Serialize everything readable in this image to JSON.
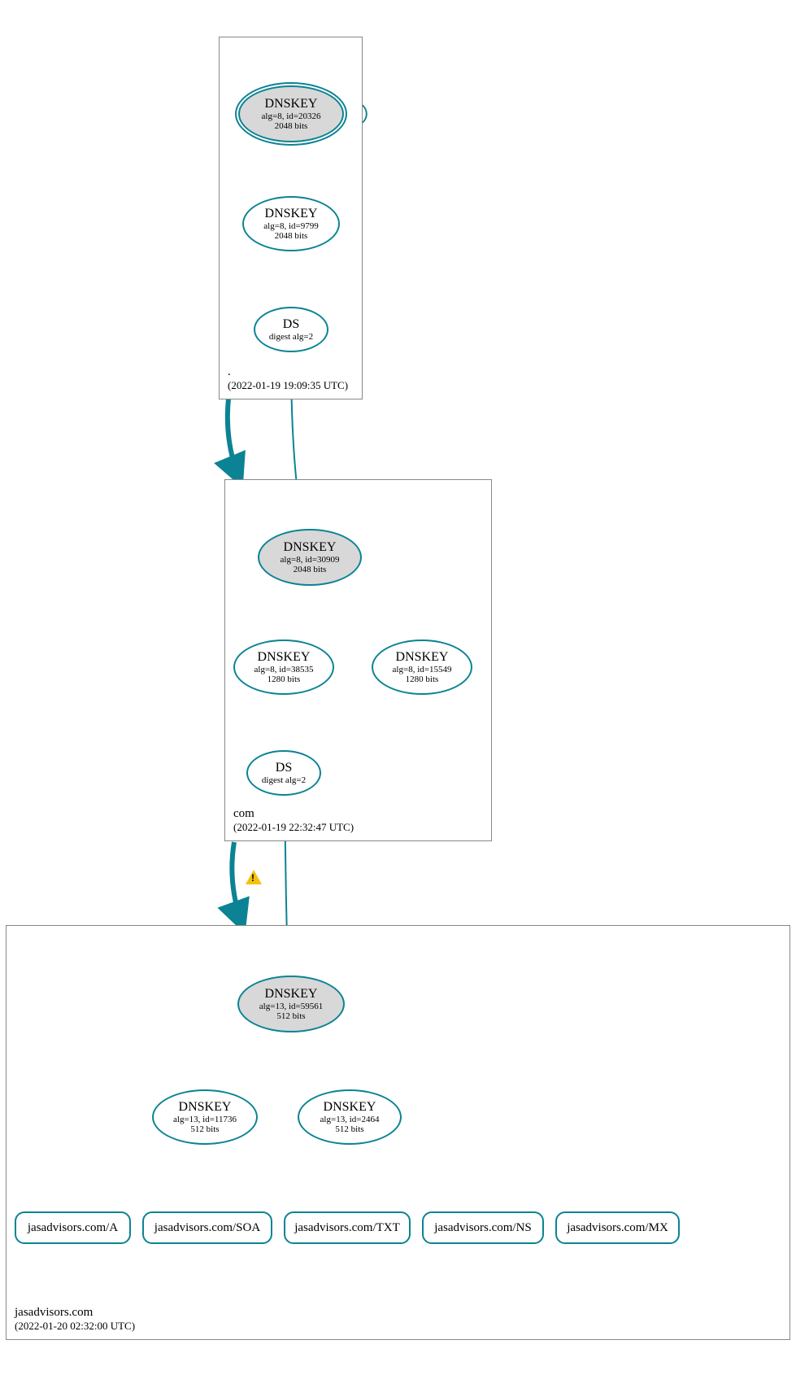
{
  "colors": {
    "teal": "#0b8394",
    "ksk_fill": "#d8d8d8"
  },
  "zones": {
    "root": {
      "name": ".",
      "time": "(2022-01-19 19:09:35 UTC)"
    },
    "com": {
      "name": "com",
      "time": "(2022-01-19 22:32:47 UTC)"
    },
    "domain": {
      "name": "jasadvisors.com",
      "time": "(2022-01-20 02:32:00 UTC)"
    }
  },
  "nodes": {
    "root_ksk": {
      "title": "DNSKEY",
      "l1": "alg=8, id=20326",
      "l2": "2048 bits"
    },
    "root_zsk": {
      "title": "DNSKEY",
      "l1": "alg=8, id=9799",
      "l2": "2048 bits"
    },
    "root_ds": {
      "title": "DS",
      "l1": "digest alg=2",
      "l2": ""
    },
    "com_ksk": {
      "title": "DNSKEY",
      "l1": "alg=8, id=30909",
      "l2": "2048 bits"
    },
    "com_zsk": {
      "title": "DNSKEY",
      "l1": "alg=8, id=38535",
      "l2": "1280 bits"
    },
    "com_zsk2": {
      "title": "DNSKEY",
      "l1": "alg=8, id=15549",
      "l2": "1280 bits"
    },
    "com_ds": {
      "title": "DS",
      "l1": "digest alg=2",
      "l2": ""
    },
    "dom_ksk": {
      "title": "DNSKEY",
      "l1": "alg=13, id=59561",
      "l2": "512 bits"
    },
    "dom_zsk2": {
      "title": "DNSKEY",
      "l1": "alg=13, id=11736",
      "l2": "512 bits"
    },
    "dom_zsk": {
      "title": "DNSKEY",
      "l1": "alg=13, id=2464",
      "l2": "512 bits"
    }
  },
  "rrset": {
    "a": "jasadvisors.com/A",
    "soa": "jasadvisors.com/SOA",
    "txt": "jasadvisors.com/TXT",
    "ns": "jasadvisors.com/NS",
    "mx": "jasadvisors.com/MX"
  }
}
